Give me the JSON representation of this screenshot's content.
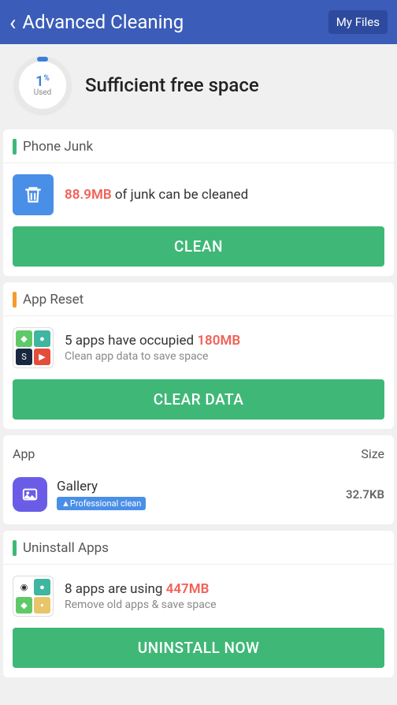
{
  "header": {
    "title": "Advanced Cleaning",
    "my_files": "My Files"
  },
  "summary": {
    "percent": "1",
    "unit": "%",
    "used_label": "Used",
    "title": "Sufficient free space"
  },
  "phone_junk": {
    "title": "Phone Junk",
    "size": "88.9MB",
    "suffix": " of junk can be cleaned",
    "button": "CLEAN"
  },
  "app_reset": {
    "title": "App Reset",
    "prefix": "5 apps have occupied ",
    "size": "180MB",
    "sub": "Clean app data to save space",
    "button": "CLEAR DATA"
  },
  "app_list": {
    "col_app": "App",
    "col_size": "Size",
    "items": [
      {
        "name": "Gallery",
        "badge": "▲Professional clean",
        "size": "32.7KB"
      }
    ]
  },
  "uninstall": {
    "title": "Uninstall Apps",
    "prefix": "8 apps are using ",
    "size": "447MB",
    "sub": "Remove old apps & save space",
    "button": "UNINSTALL NOW"
  }
}
